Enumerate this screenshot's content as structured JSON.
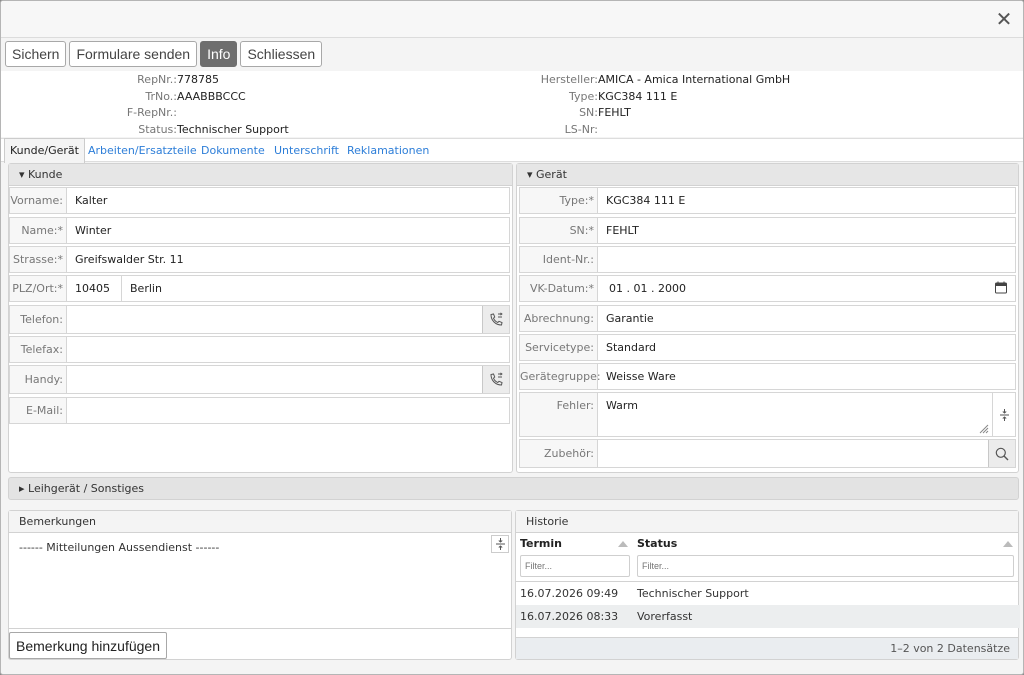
{
  "window": {
    "close_glyph": "✕"
  },
  "toolbar": {
    "save": "Sichern",
    "send_forms": "Formulare senden",
    "info": "Info",
    "close": "Schliessen"
  },
  "info": {
    "repnr_label": "RepNr.:",
    "repnr": "778785",
    "trno_label": "TrNo.:",
    "trno": "AAABBBCCC",
    "frepnr_label": "F-RepNr.:",
    "frepnr": "",
    "status_label": "Status:",
    "status": "Technischer Support",
    "hersteller_label": "Hersteller:",
    "hersteller": "AMICA - Amica International GmbH",
    "type_label": "Type:",
    "type": "KGC384 111 E",
    "sn_label": "SN:",
    "sn": "FEHLT",
    "lsnr_label": "LS-Nr:",
    "lsnr": ""
  },
  "tabs": [
    "Kunde/Gerät",
    "Arbeiten/Ersatzteile",
    "Dokumente",
    "Unterschrift",
    "Reklamationen"
  ],
  "kunde": {
    "header": "▾ Kunde",
    "vorname_label": "Vorname:",
    "vorname": "Kalter",
    "name_label": "Name:*",
    "name": "Winter",
    "strasse_label": "Strasse:*",
    "strasse": "Greifswalder Str. 11",
    "plzort_label": "PLZ/Ort:*",
    "plz": "10405",
    "ort": "Berlin",
    "telefon_label": "Telefon:",
    "telefon": "",
    "telefax_label": "Telefax:",
    "telefax": "",
    "handy_label": "Handy:",
    "handy": "",
    "email_label": "E-Mail:",
    "email": ""
  },
  "geraet": {
    "header": "▾ Gerät",
    "type_label": "Type:*",
    "type": "KGC384 111 E",
    "sn_label": "SN:*",
    "sn": "FEHLT",
    "ident_label": "Ident-Nr.:",
    "ident": "",
    "vk_label": "VK-Datum:*",
    "vk": "01 . 01 . 2000",
    "abrechnung_label": "Abrechnung:",
    "abrechnung": "Garantie",
    "servicetype_label": "Servicetype:",
    "servicetype": "Standard",
    "geraetegruppe_label": "Gerätegruppe:",
    "geraetegruppe": "Weisse Ware",
    "fehler_label": "Fehler:",
    "fehler": "Warm",
    "zubehoer_label": "Zubehör:",
    "zubehoer": ""
  },
  "leihgeraet": {
    "header": "▸ Leihgerät / Sonstiges"
  },
  "bemerkungen": {
    "header": "Bemerkungen",
    "text": "------ Mitteilungen Aussendienst ------",
    "add_button": "Bemerkung hinzufügen"
  },
  "historie": {
    "header": "Historie",
    "col_termin": "Termin",
    "col_status": "Status",
    "filter_placeholder": "Filter...",
    "rows": [
      {
        "termin": "16.07.2026 09:49",
        "status": "Technischer Support"
      },
      {
        "termin": "16.07.2026 08:33",
        "status": "Vorerfasst"
      }
    ],
    "footer": "1–2 von 2 Datensätze"
  },
  "colors": {
    "accent": "#2d7ed8",
    "active_button": "#6e6e6e",
    "panel_header": "#e6e6e6"
  }
}
